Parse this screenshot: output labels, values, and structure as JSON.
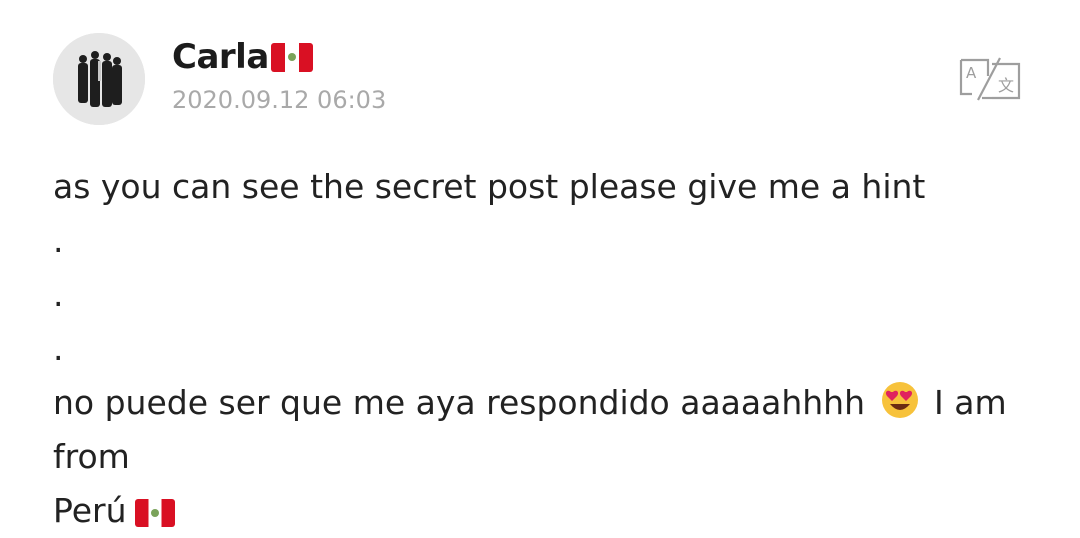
{
  "post": {
    "author": {
      "name": "Carla",
      "flag_icon": "peru-flag-icon",
      "avatar_icon": "group-photo-avatar"
    },
    "timestamp": "2020.09.12 06:03",
    "translate_icon": "translate-icon",
    "lines": {
      "line1": "as you can see the secret post please give me a hint",
      "dot1": ".",
      "dot2": ".",
      "dot3": ".",
      "line5_part1": "no puede ser que me aya respondido aaaaahhhh",
      "line5_emoji": "heart-eyes-emoji-icon",
      "line5_part2": "I am from",
      "line6": "Perú"
    },
    "colors": {
      "text": "#222222",
      "timestamp": "#a9a9a9",
      "flag_red": "#d91023",
      "icon_gray": "#9e9e9e"
    }
  }
}
